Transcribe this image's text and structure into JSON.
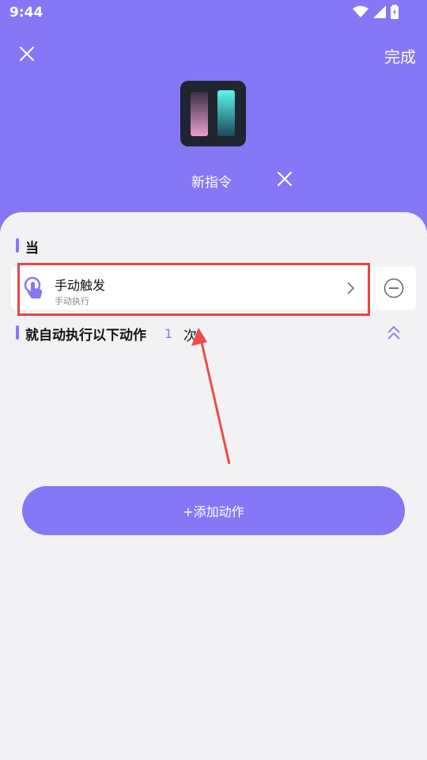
{
  "status_bar": {
    "time": "9:44"
  },
  "header": {
    "done_label": "完成",
    "command_title": "新指令"
  },
  "when_section": {
    "label": "当",
    "trigger": {
      "title": "手动触发",
      "subtitle": "手动执行"
    }
  },
  "then_section": {
    "label": "就自动执行以下动作",
    "count": "1",
    "count_unit": "次"
  },
  "add_action_label": "+添加动作",
  "colors": {
    "accent": "#8677f7",
    "highlight": "#e84545",
    "background": "#f2f2f4"
  }
}
